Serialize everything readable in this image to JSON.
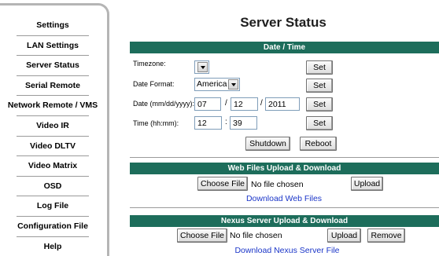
{
  "page": {
    "title": "Server Status"
  },
  "nav": {
    "items": [
      {
        "label": "Settings"
      },
      {
        "label": "LAN Settings"
      },
      {
        "label": "Server Status"
      },
      {
        "label": "Serial Remote"
      },
      {
        "label": "Network Remote / VMS"
      },
      {
        "label": "Video IR"
      },
      {
        "label": "Video DLTV"
      },
      {
        "label": "Video Matrix"
      },
      {
        "label": "OSD"
      },
      {
        "label": "Log File"
      },
      {
        "label": "Configuration File"
      },
      {
        "label": "Help"
      }
    ]
  },
  "datetime": {
    "header": "Date / Time",
    "timezone": {
      "label": "Timezone:",
      "value": "",
      "set_label": "Set"
    },
    "date_format": {
      "label": "Date Format:",
      "value": "America",
      "set_label": "Set"
    },
    "date": {
      "label": "Date (mm/dd/yyyy):",
      "month": "07",
      "day": "12",
      "year": "2011",
      "sep": "/",
      "set_label": "Set"
    },
    "time": {
      "label": "Time (hh:mm):",
      "hours": "12",
      "minutes": "39",
      "sep": ":",
      "set_label": "Set"
    },
    "shutdown_label": "Shutdown",
    "reboot_label": "Reboot"
  },
  "web_files": {
    "header": "Web Files Upload & Download",
    "choose_label": "Choose File",
    "file_status": "No file chosen",
    "upload_label": "Upload",
    "download_link": "Download Web Files"
  },
  "nexus": {
    "header": "Nexus Server Upload & Download",
    "choose_label": "Choose File",
    "file_status": "No file chosen",
    "upload_label": "Upload",
    "remove_label": "Remove",
    "download_link": "Download Nexus Server File"
  },
  "colors": {
    "section_bar": "#1d6d5b",
    "link": "#1a35c8"
  }
}
